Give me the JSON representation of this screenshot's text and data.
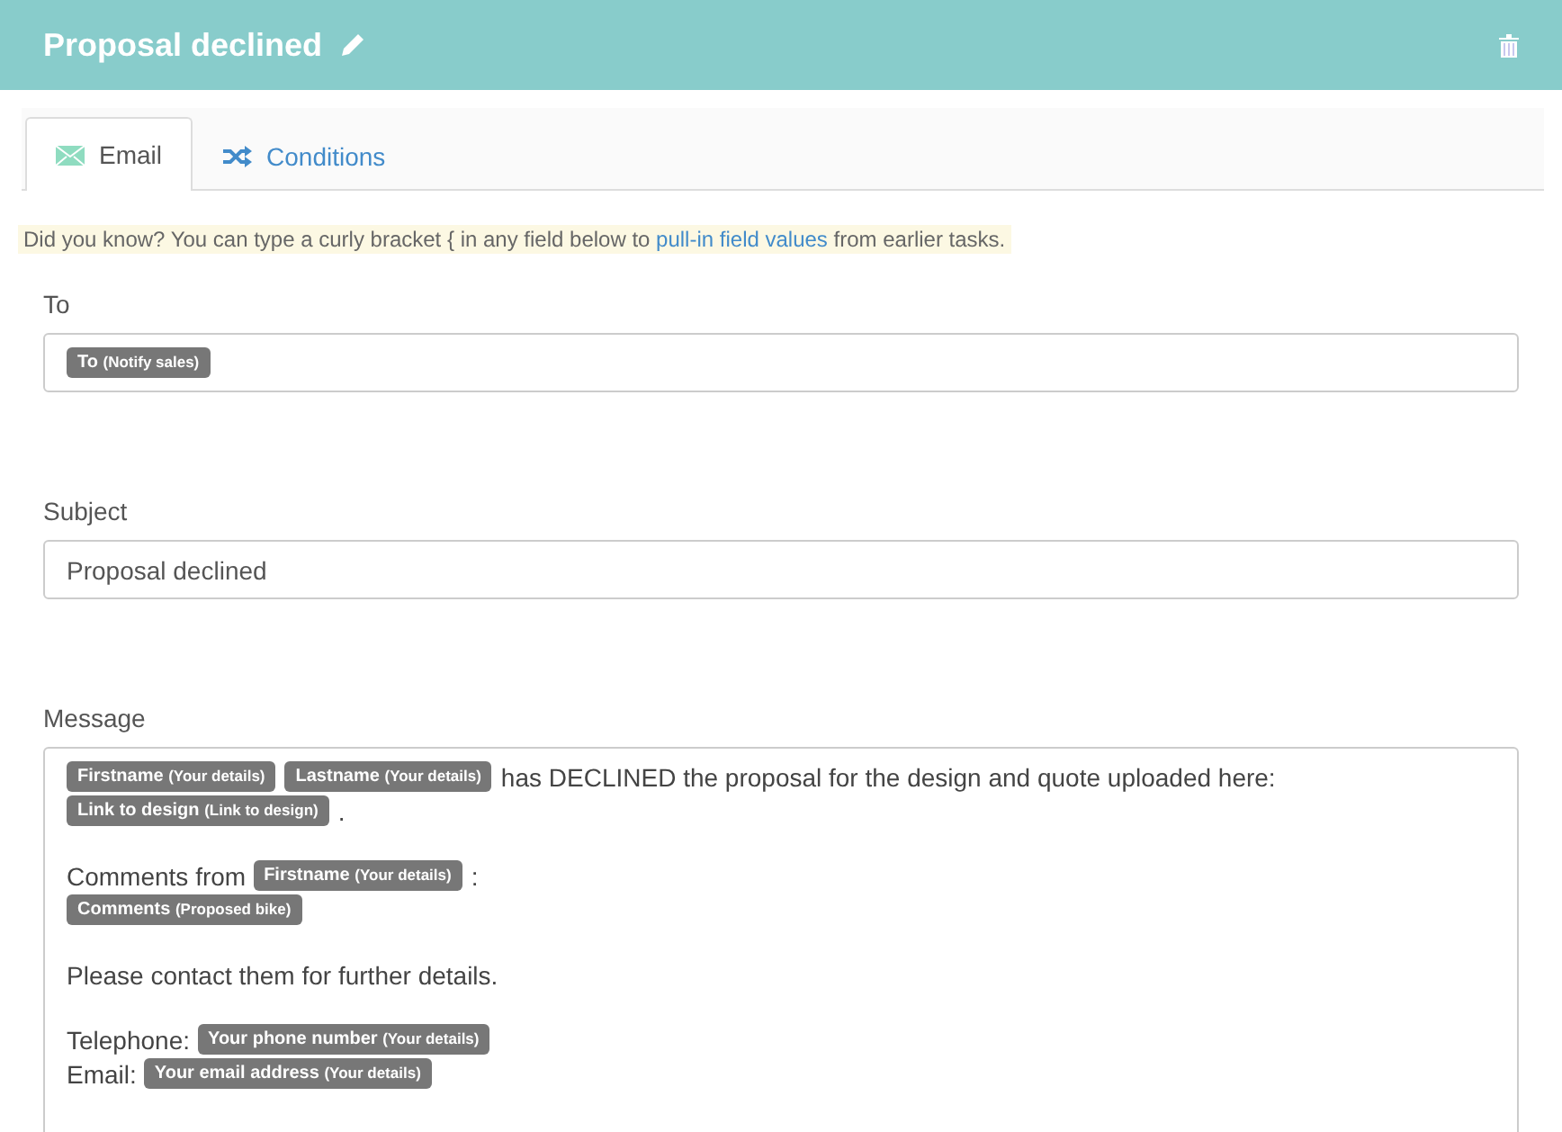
{
  "header": {
    "title": "Proposal declined"
  },
  "tabs": [
    {
      "label": "Email",
      "kind": "email",
      "selected": true
    },
    {
      "label": "Conditions",
      "kind": "shuffle",
      "selected": false
    }
  ],
  "hint": {
    "before": "Did you know? You can type a curly bracket { in any field below to ",
    "link": "pull-in field values",
    "after": " from earlier tasks."
  },
  "to": {
    "label": "To",
    "tokens": [
      {
        "field": "To",
        "source": "(Notify sales)"
      }
    ]
  },
  "subject": {
    "label": "Subject",
    "value": "Proposal declined"
  },
  "message": {
    "label": "Message",
    "paragraphs": [
      {
        "lines": [
          [
            {
              "kind": "token",
              "field": "Firstname",
              "source": "(Your details)"
            },
            {
              "kind": "token",
              "field": "Lastname",
              "source": "(Your details)"
            },
            {
              "kind": "text",
              "text": "has DECLINED the proposal for the design and quote uploaded here:"
            }
          ],
          [
            {
              "kind": "token",
              "field": "Link to design",
              "source": "(Link to design)"
            },
            {
              "kind": "text",
              "text": "."
            }
          ]
        ]
      },
      {
        "lines": [
          [
            {
              "kind": "text",
              "text": "Comments from"
            },
            {
              "kind": "token",
              "field": "Firstname",
              "source": "(Your details)"
            },
            {
              "kind": "text",
              "text": ":"
            }
          ],
          [
            {
              "kind": "token",
              "field": "Comments",
              "source": "(Proposed bike)"
            }
          ]
        ]
      },
      {
        "lines": [
          [
            {
              "kind": "text",
              "text": "Please contact them for further details."
            }
          ]
        ]
      },
      {
        "lines": [
          [
            {
              "kind": "text",
              "text": "Telephone:"
            },
            {
              "kind": "token",
              "field": "Your phone number",
              "source": "(Your details)"
            }
          ],
          [
            {
              "kind": "text",
              "text": "Email:"
            },
            {
              "kind": "token",
              "field": "Your email address",
              "source": "(Your details)"
            }
          ]
        ]
      }
    ]
  }
}
